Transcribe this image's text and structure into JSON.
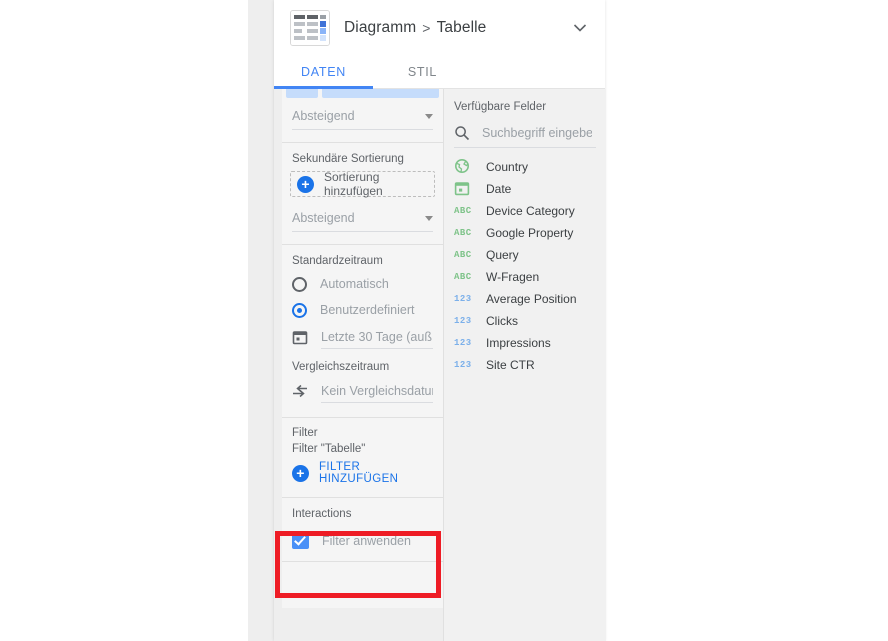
{
  "header": {
    "icon": "table-chart-icon",
    "title_part1": "Diagramm",
    "separator": ">",
    "title_part2": "Tabelle",
    "collapse_icon": "chevron-down-icon"
  },
  "tabs": [
    {
      "label": "DATEN",
      "active": true
    },
    {
      "label": "STIL",
      "active": false
    }
  ],
  "sort": {
    "primary_order_value": "Absteigend",
    "secondary_title": "Sekundäre Sortierung",
    "add_sort_label": "Sortierung hinzufügen",
    "secondary_order_value": "Absteigend"
  },
  "date_range": {
    "title": "Standardzeitraum",
    "option_auto": "Automatisch",
    "option_custom": "Benutzerdefiniert",
    "selected": "Benutzerdefiniert",
    "custom_value": "Letzte 30 Tage (auß…",
    "compare_title": "Vergleichszeitraum",
    "compare_value": "Kein Vergleichsdatum"
  },
  "filter": {
    "title": "Filter",
    "subtitle": "Filter \"Tabelle\"",
    "add_label": "FILTER HINZUFÜGEN"
  },
  "interactions": {
    "title": "Interactions",
    "checkbox_label": "Filter anwenden",
    "checkbox_checked": true,
    "highlight_color": "#ee1c25"
  },
  "available_fields": {
    "title": "Verfügbare Felder",
    "search_placeholder": "Suchbegriff eingeben",
    "search_value": "",
    "items": [
      {
        "label": "Country",
        "type": "geo",
        "badge": ""
      },
      {
        "label": "Date",
        "type": "date",
        "badge": ""
      },
      {
        "label": "Device Category",
        "type": "text",
        "badge": "ABC"
      },
      {
        "label": "Google Property",
        "type": "text",
        "badge": "ABC"
      },
      {
        "label": "Query",
        "type": "text",
        "badge": "ABC"
      },
      {
        "label": "W-Fragen",
        "type": "text",
        "badge": "ABC"
      },
      {
        "label": "Average Position",
        "type": "number",
        "badge": "123"
      },
      {
        "label": "Clicks",
        "type": "number",
        "badge": "123"
      },
      {
        "label": "Impressions",
        "type": "number",
        "badge": "123"
      },
      {
        "label": "Site CTR",
        "type": "number",
        "badge": "123"
      }
    ]
  },
  "colors": {
    "accent_blue": "#1a73e8",
    "tab_blue": "#4285f4",
    "chip_blue": "#c5dcfb",
    "text_muted": "#9aa0a6",
    "highlight_red": "#ee1c25"
  }
}
